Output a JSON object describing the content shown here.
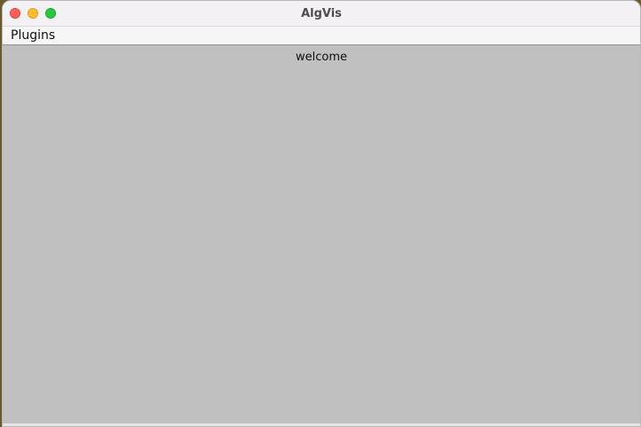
{
  "window": {
    "title": "AlgVis"
  },
  "menubar": {
    "items": [
      {
        "label": "Plugins"
      }
    ]
  },
  "content": {
    "welcome_text": "welcome"
  },
  "colors": {
    "close": "#ff5f57",
    "minimize": "#febc2e",
    "zoom": "#28c840",
    "content_background": "#c0c0c0"
  },
  "icons": {
    "close": "close-icon",
    "minimize": "minimize-icon",
    "zoom": "zoom-icon"
  }
}
